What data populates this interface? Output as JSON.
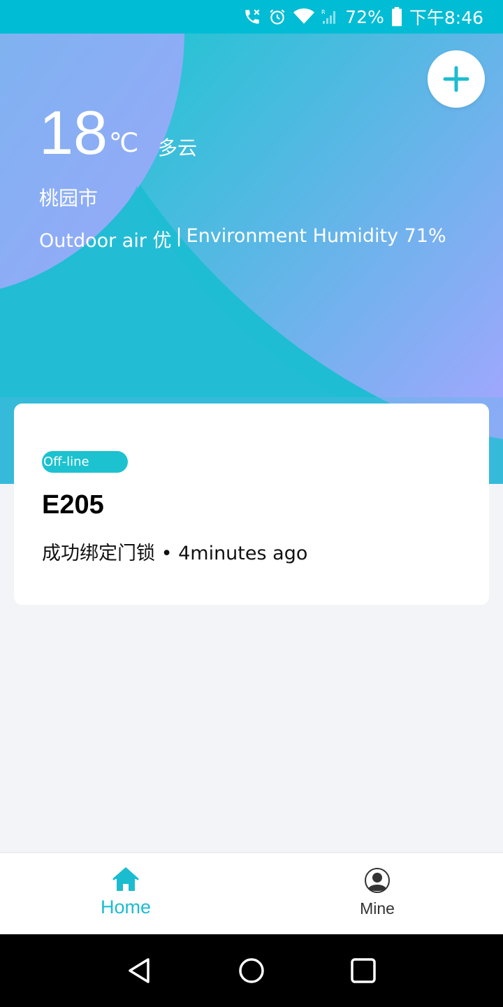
{
  "status_bar": {
    "battery_percent": "72%",
    "time": "下午8:46",
    "icons": [
      "call-icon",
      "alarm-icon",
      "wifi-icon",
      "signal-icon",
      "battery-icon"
    ]
  },
  "weather": {
    "temperature": "18",
    "unit": "℃",
    "condition": "多云",
    "city": "桃园市",
    "air_quality_label": "Outdoor air 优",
    "separator": "|",
    "humidity_label": "Environment Humidity 71%"
  },
  "device": {
    "status": "Off-line",
    "name": "E205",
    "info": "成功绑定门锁 • 4minutes ago"
  },
  "tabs": [
    {
      "label": "Home",
      "icon": "home-icon",
      "active": true
    },
    {
      "label": "Mine",
      "icon": "user-avatar-icon",
      "active": false
    }
  ],
  "colors": {
    "accent": "#1cbcd0",
    "status_bar": "#00bcd4",
    "hero_blob": "#a5a8fc"
  }
}
